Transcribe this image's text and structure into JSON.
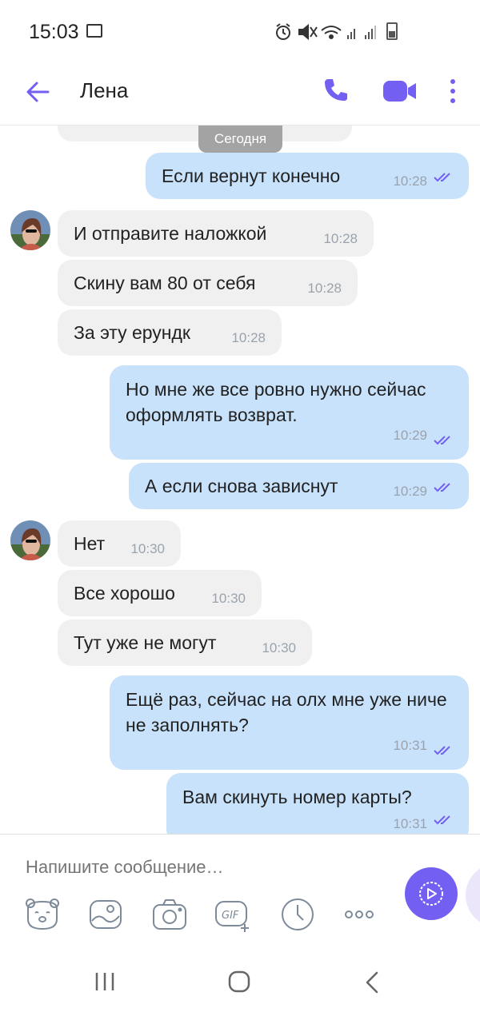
{
  "status_bar": {
    "time": "15:03"
  },
  "header": {
    "contact_name": "Лена"
  },
  "colors": {
    "accent": "#7360f2",
    "incoming_bubble": "#f0f0f0",
    "outgoing_bubble": "#c8e2fb",
    "time": "#9aa3ad"
  },
  "date_chip": "Сегодня",
  "messages": [
    {
      "dir": "out",
      "text": "Если вернут конечно",
      "time": "10:28"
    },
    {
      "dir": "in",
      "text": "И отправите наложкой",
      "time": "10:28"
    },
    {
      "dir": "in",
      "text": "Скину вам 80 от себя",
      "time": "10:28"
    },
    {
      "dir": "in",
      "text": "За эту ерундк",
      "time": "10:28"
    },
    {
      "dir": "out",
      "text": "Но мне же все ровно нужно сейчас оформлять возврат.",
      "time": "10:29"
    },
    {
      "dir": "out",
      "text": "А если снова зависнут",
      "time": "10:29"
    },
    {
      "dir": "in",
      "text": "Нет",
      "time": "10:30"
    },
    {
      "dir": "in",
      "text": "Все хорошо",
      "time": "10:30"
    },
    {
      "dir": "in",
      "text": "Тут уже не могут",
      "time": "10:30"
    },
    {
      "dir": "out",
      "text": "Ещё раз, сейчас на олх мне уже ниче не заполнять?",
      "time": "10:31"
    },
    {
      "dir": "out",
      "text": "Вам скинуть номер карты?",
      "time": "10:31"
    }
  ],
  "composer": {
    "placeholder": "Напишите сообщение…"
  },
  "icons": {
    "header": [
      "back-arrow-icon",
      "phone-icon",
      "video-call-icon",
      "more-vertical-icon"
    ],
    "toolbar": [
      "sticker-bear-icon",
      "gallery-icon",
      "camera-icon",
      "gif-icon",
      "clock-icon",
      "more-horizontal-icon"
    ],
    "nav": [
      "recent-apps-icon",
      "home-icon",
      "back-icon"
    ]
  }
}
